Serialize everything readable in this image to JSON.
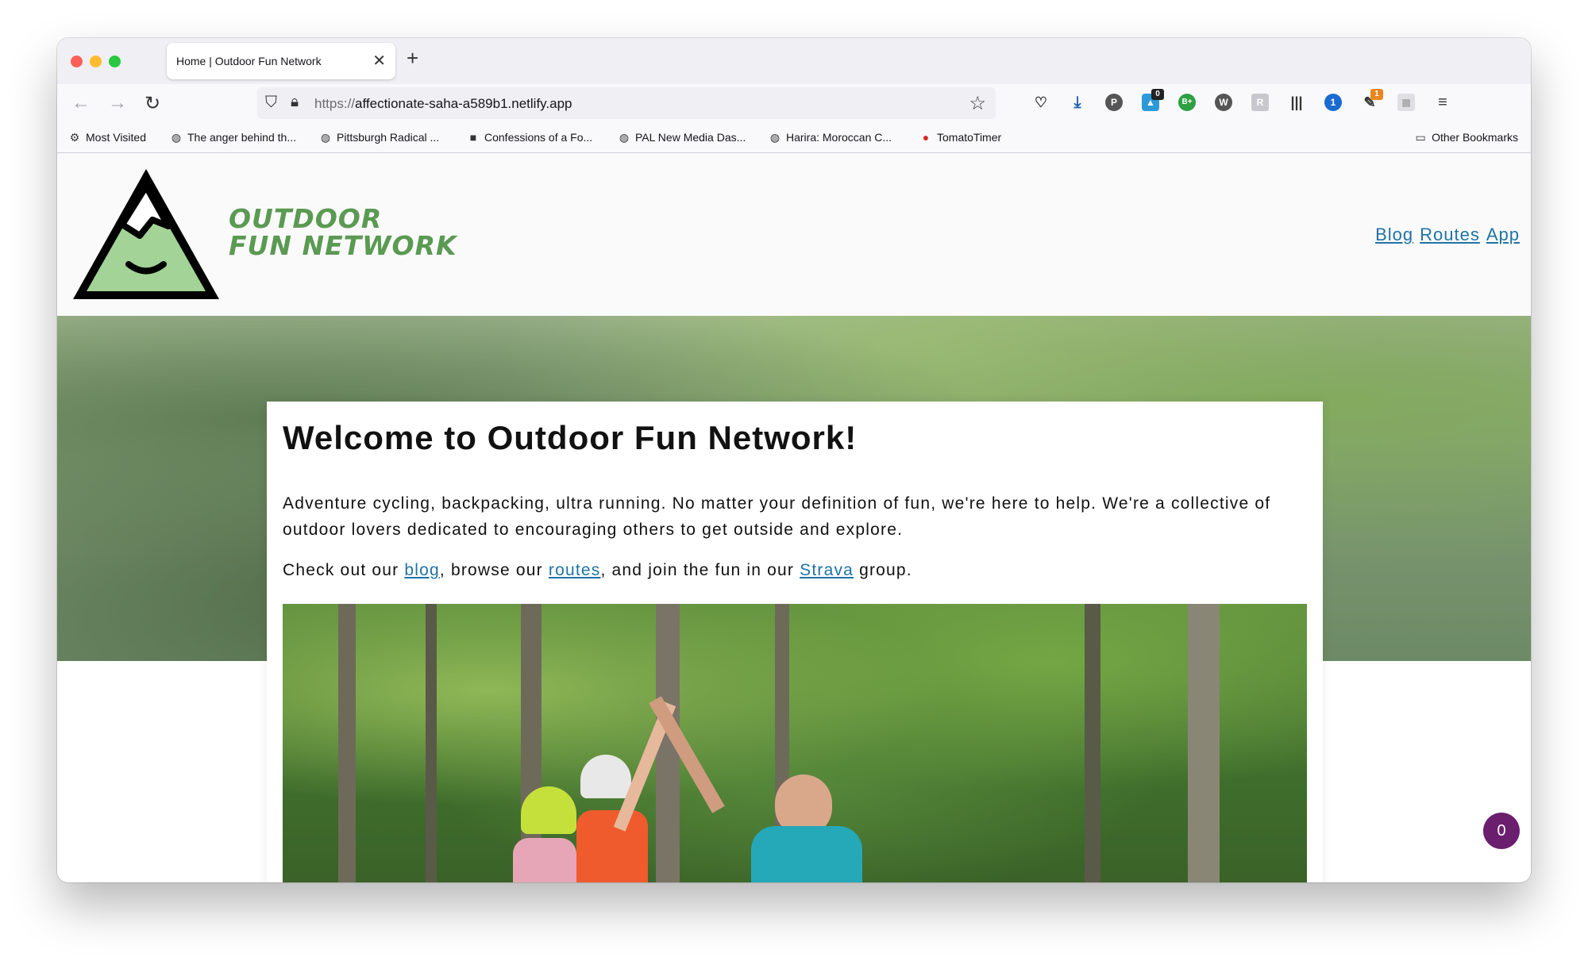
{
  "browser": {
    "tab_title": "Home | Outdoor Fun Network",
    "tab_close": "✕",
    "new_tab": "+",
    "url_scheme": "https://",
    "url_host": "affectionate-saha-a589b1.netlify.app",
    "extensions": [
      {
        "icon": "pocket-icon",
        "badge": ""
      },
      {
        "icon": "download-icon",
        "badge": ""
      },
      {
        "icon": "p-extension-icon",
        "badge": ""
      },
      {
        "icon": "notification-extension-icon",
        "badge": "0"
      },
      {
        "icon": "b-plus-extension-icon",
        "badge": ""
      },
      {
        "icon": "w-extension-icon",
        "badge": ""
      },
      {
        "icon": "translate-extension-icon",
        "badge": ""
      },
      {
        "icon": "barcode-extension-icon",
        "badge": ""
      },
      {
        "icon": "password-manager-icon",
        "badge": ""
      },
      {
        "icon": "feather-extension-icon",
        "badge": "1"
      },
      {
        "icon": "grid-extension-icon",
        "badge": ""
      },
      {
        "icon": "menu-icon",
        "badge": ""
      }
    ]
  },
  "bookmarks": {
    "items": [
      {
        "label": "Most Visited",
        "icon": "gear-icon"
      },
      {
        "label": "The anger behind th...",
        "icon": "globe-icon"
      },
      {
        "label": "Pittsburgh Radical ...",
        "icon": "globe-icon"
      },
      {
        "label": "Confessions of a Fo...",
        "icon": "video-icon"
      },
      {
        "label": "PAL New Media Das...",
        "icon": "globe-icon"
      },
      {
        "label": "Harira: Moroccan C...",
        "icon": "globe-icon"
      },
      {
        "label": "TomatoTimer",
        "icon": "tomato-icon"
      }
    ],
    "other": "Other Bookmarks"
  },
  "site": {
    "logo_line1": "OUTDOOR",
    "logo_line2": "FUN NETWORK",
    "nav": [
      "Blog",
      "Routes",
      "App"
    ],
    "heading": "Welcome to Outdoor Fun Network!",
    "intro": "Adventure cycling, backpacking, ultra running. No matter your definition of fun, we're here to help. We're a collective of outdoor lovers dedicated to encouraging others to get outside and explore.",
    "cta_prefix": "Check out our ",
    "cta_blog": "blog",
    "cta_mid1": ", browse our ",
    "cta_routes": "routes",
    "cta_mid2": ", and join the fun in our ",
    "cta_strava": "Strava",
    "cta_suffix": " group."
  },
  "chat": {
    "count": "0"
  },
  "colors": {
    "brand_green": "#5a9a52",
    "link": "#1f73a3",
    "chat_bg": "#6b1e6e"
  }
}
